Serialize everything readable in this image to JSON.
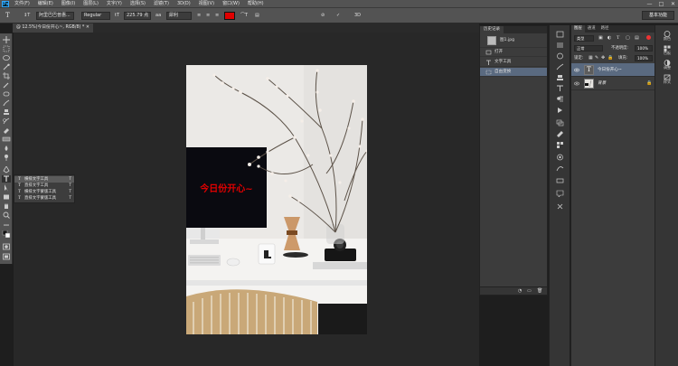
{
  "menubar": {
    "logo": "Ps",
    "items": [
      "文件(F)",
      "编辑(E)",
      "图像(I)",
      "图层(L)",
      "文字(Y)",
      "选择(S)",
      "滤镜(T)",
      "3D(D)",
      "视图(V)",
      "窗口(W)",
      "帮助(H)"
    ],
    "window_controls": [
      "—",
      "□",
      "✕"
    ]
  },
  "options": {
    "tool_glyph": "T",
    "orient_glyph": "↕T",
    "font_family": "阿里巴巴普惠...",
    "font_style": "Regular",
    "size_glyph": "tT",
    "font_size": "225.79 点",
    "aa_glyph": "aa",
    "antialias": "犀利",
    "align_glyphs": [
      "≡",
      "≡",
      "≡"
    ],
    "text_color": "#e00000",
    "warp_glyph": "⌒T",
    "panel_glyph": "▤",
    "cancel_glyph": "⊘",
    "commit_glyph": "✓",
    "center_glyph": "3D",
    "workspace": "基本功能"
  },
  "document": {
    "tab_label": "@ 12.5%(今日份开心~, RGB/8) *  ✕",
    "overlay_text": "今日份开心~",
    "overlay_text_color": "#e00000",
    "screen_logo": ""
  },
  "tool_flyout": {
    "items": [
      {
        "glyph": "T",
        "label": "横排文字工具",
        "key": "T"
      },
      {
        "glyph": "T",
        "label": "直排文字工具",
        "key": "T"
      },
      {
        "glyph": "T",
        "label": "横排文字蒙版工具",
        "key": "T"
      },
      {
        "glyph": "T",
        "label": "直排文字蒙版工具",
        "key": "T"
      }
    ]
  },
  "history": {
    "tab": "历史记录",
    "snapshot": "图1.jpg",
    "steps": [
      "打开",
      "文字工具",
      "自由变换"
    ],
    "footer_glyphs": [
      "◔",
      "▭",
      "🗑"
    ]
  },
  "layers": {
    "tabs": [
      "图层",
      "通道",
      "路径"
    ],
    "kind_filter": "类型",
    "blend_mode": "正常",
    "opacity_label": "不透明度:",
    "opacity": "100%",
    "lock_label": "锁定:",
    "fill_label": "填充:",
    "fill": "100%",
    "items": [
      {
        "thumb": "T",
        "name": "今日份开心~"
      },
      {
        "thumb": "",
        "name": "背景"
      }
    ]
  },
  "right_strip": {
    "items": [
      {
        "label": "颜色"
      },
      {
        "label": "色板"
      },
      {
        "label": "调整"
      },
      {
        "label": "样式"
      }
    ]
  }
}
